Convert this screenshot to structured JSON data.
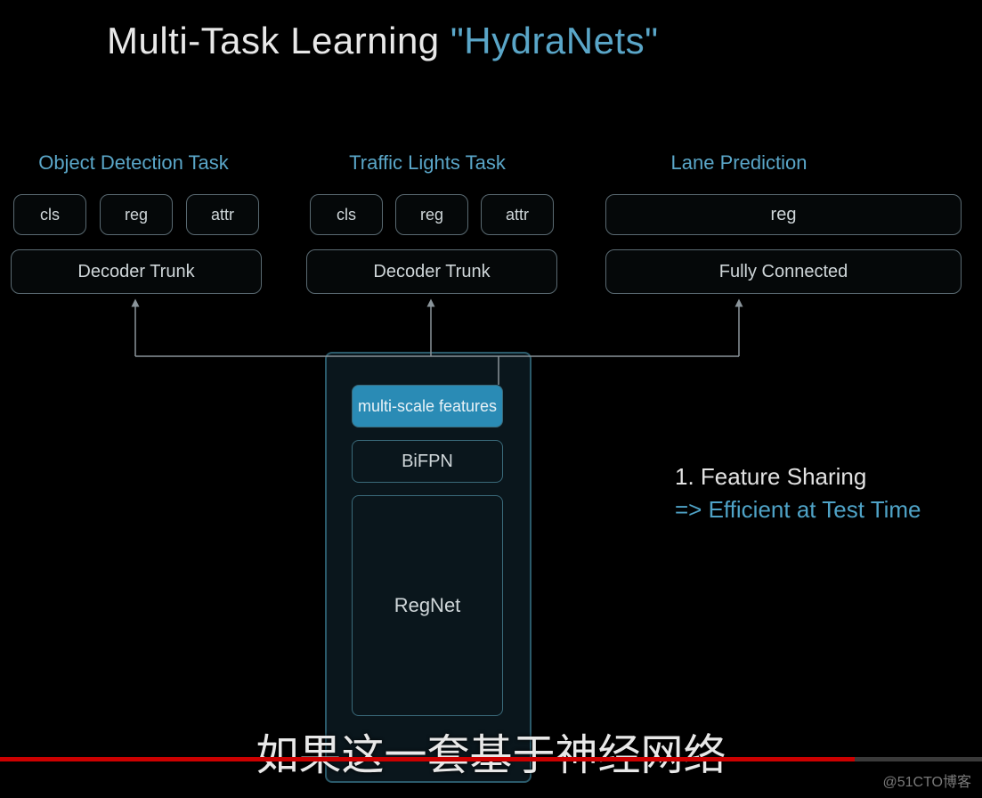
{
  "title": {
    "main": "Multi-Task Learning",
    "accent": "\"HydraNets\""
  },
  "columns": [
    {
      "title": "Object Detection Task",
      "heads": [
        "cls",
        "reg",
        "attr"
      ],
      "trunk": "Decoder Trunk"
    },
    {
      "title": "Traffic Lights Task",
      "heads": [
        "cls",
        "reg",
        "attr"
      ],
      "trunk": "Decoder Trunk"
    },
    {
      "title": "Lane Prediction",
      "heads_wide": "reg",
      "trunk": "Fully Connected"
    }
  ],
  "backbone": {
    "msf": "multi-scale features",
    "bifpn": "BiFPN",
    "regnet": "RegNet"
  },
  "side": {
    "l1": "1. Feature Sharing",
    "l2": "=> Efficient at Test Time"
  },
  "subtitle": "如果这一套基于神经网络",
  "watermark": "@51CTO博客"
}
